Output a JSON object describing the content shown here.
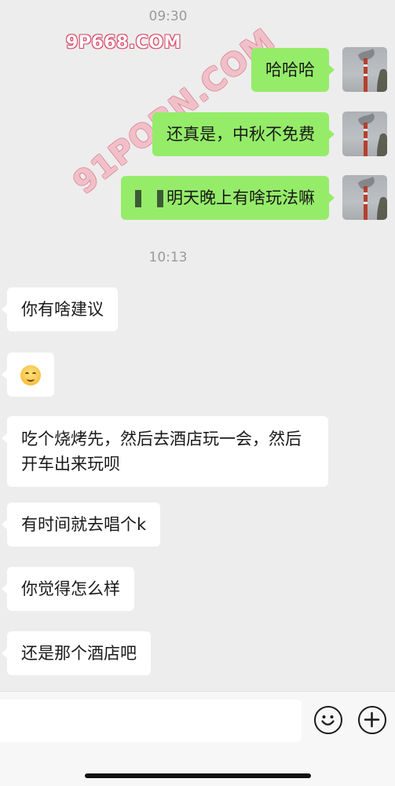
{
  "timestamps": [
    "09:30",
    "10:13"
  ],
  "watermarks": [
    "9P668.COM",
    "91PORN.COM"
  ],
  "sent_messages": [
    {
      "text": "哈哈哈"
    },
    {
      "text": "还真是，中秋不免费"
    },
    {
      "text": "明天晚上有啥玩法嘛"
    }
  ],
  "received_messages": [
    {
      "text": "你有啥建议"
    },
    {
      "emoji": "smiling-face-emoji"
    },
    {
      "text": "吃个烧烤先，然后去酒店玩一会，然后开车出来玩呗"
    },
    {
      "text": "有时间就去唱个k"
    },
    {
      "text": "你觉得怎么样"
    },
    {
      "text": "还是那个酒店吧"
    }
  ],
  "composer": {
    "emoji_icon": "smile-face-icon",
    "more_icon": "plus-circle-icon"
  },
  "colors": {
    "background": "#ededed",
    "sent_bubble": "#95ec69",
    "received_bubble": "#ffffff"
  }
}
